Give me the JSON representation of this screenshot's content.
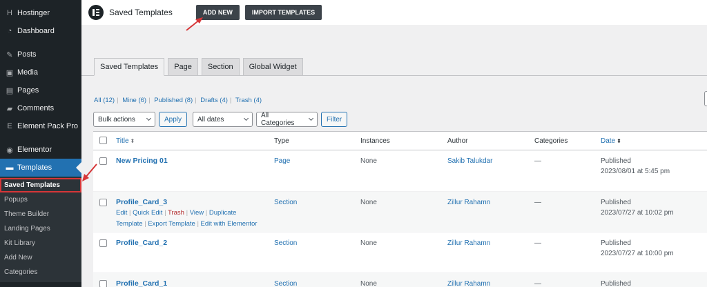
{
  "sidebar": {
    "items": [
      {
        "label": "Hostinger",
        "icon": "hostinger-icon",
        "glyph": "H"
      },
      {
        "label": "Dashboard",
        "icon": "dashboard-icon",
        "glyph": "◔"
      },
      {
        "label": "Posts",
        "icon": "pin-icon",
        "glyph": "✎"
      },
      {
        "label": "Media",
        "icon": "media-icon",
        "glyph": "▣"
      },
      {
        "label": "Pages",
        "icon": "pages-icon",
        "glyph": "▤"
      },
      {
        "label": "Comments",
        "icon": "comments-icon",
        "glyph": "▰"
      },
      {
        "label": "Element Pack Pro",
        "icon": "element-pack-icon",
        "glyph": "E"
      },
      {
        "label": "Elementor",
        "icon": "elementor-icon",
        "glyph": "◉"
      },
      {
        "label": "Templates",
        "icon": "folder-icon",
        "glyph": "▬"
      }
    ],
    "submenu": [
      "Saved Templates",
      "Popups",
      "Theme Builder",
      "Landing Pages",
      "Kit Library",
      "Add New",
      "Categories"
    ]
  },
  "header": {
    "title": "Saved Templates",
    "add_new": "ADD NEW",
    "import": "IMPORT TEMPLATES"
  },
  "tabs": [
    "Saved Templates",
    "Page",
    "Section",
    "Global Widget"
  ],
  "filters": {
    "all": "All",
    "all_count": "(12)",
    "mine": "Mine",
    "mine_count": "(6)",
    "published": "Published",
    "published_count": "(8)",
    "drafts": "Drafts",
    "drafts_count": "(4)",
    "trash": "Trash",
    "trash_count": "(4)",
    "sep": "|"
  },
  "actions": {
    "bulk": "Bulk actions",
    "apply": "Apply",
    "dates": "All dates",
    "categories": "All Categories",
    "filter": "Filter"
  },
  "table": {
    "columns": {
      "title": "Title",
      "type": "Type",
      "instances": "Instances",
      "author": "Author",
      "categories": "Categories",
      "date": "Date"
    },
    "sort_glyph": "⬍",
    "rows": [
      {
        "title": "New Pricing 01",
        "type": "Page",
        "instances": "None",
        "author": "Sakib Talukdar",
        "categories": "—",
        "status": "Published",
        "date": "2023/08/01 at 5:45 pm"
      },
      {
        "title": "Profile_Card_3",
        "type": "Section",
        "instances": "None",
        "author": "Zillur Rahamn",
        "categories": "—",
        "status": "Published",
        "date": "2023/07/27 at 10:02 pm"
      },
      {
        "title": "Profile_Card_2",
        "type": "Section",
        "instances": "None",
        "author": "Zillur Rahamn",
        "categories": "—",
        "status": "Published",
        "date": "2023/07/27 at 10:00 pm"
      },
      {
        "title": "Profile_Card_1",
        "type": "Section",
        "instances": "None",
        "author": "Zillur Rahamn",
        "categories": "—",
        "status": "Published",
        "date": ""
      }
    ],
    "row_actions": {
      "edit": "Edit",
      "quick_edit": "Quick Edit",
      "trash": "Trash",
      "view": "View",
      "duplicate": "Duplicate",
      "duplicate_cont": "Template",
      "export": "Export Template",
      "edit_elementor": "Edit with Elementor",
      "sep": "|"
    }
  },
  "colors": {
    "accent": "#2271b1",
    "sidebar": "#1d2327",
    "highlight": "#d63638"
  }
}
